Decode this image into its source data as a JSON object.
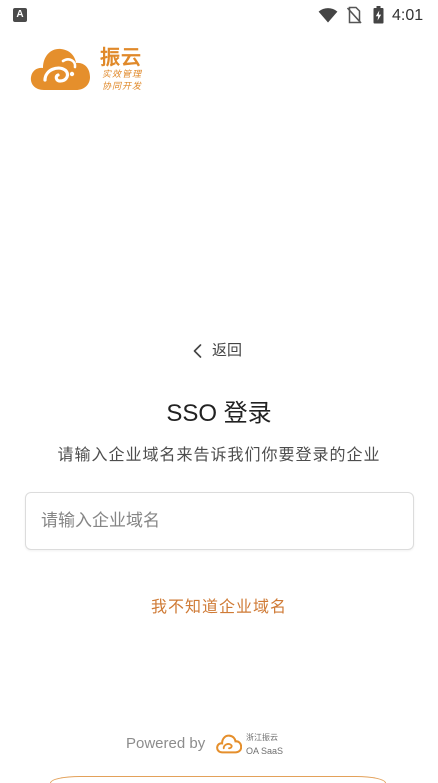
{
  "status_bar": {
    "notification_badge": "A",
    "time": "4:01",
    "icons": [
      "text-notification-icon",
      "wifi-icon",
      "no-sim-icon",
      "battery-charging-icon"
    ]
  },
  "logo": {
    "brand": "振云",
    "tagline_1": "实效管理",
    "tagline_2": "协同开发",
    "icon": "cloud-logo-icon"
  },
  "back": {
    "label": "返回",
    "icon": "chevron-left-icon"
  },
  "title": "SSO 登录",
  "subtitle": "请输入企业域名来告诉我们你要登录的企业",
  "domain_input": {
    "placeholder": "请输入企业域名"
  },
  "help_link": "我不知道企业域名",
  "footer": {
    "powered_by": "Powered by",
    "brand_line_1": "浙江振云",
    "brand_line_2": "OA SaaS",
    "icon": "cloud-logo-icon"
  },
  "colors": {
    "accent": "#E0892A",
    "link": "#CF7A35",
    "title_text": "#222222",
    "muted_text": "#8C8C8C",
    "input_border": "#DCDCDC",
    "background": "#FFFFFF"
  }
}
